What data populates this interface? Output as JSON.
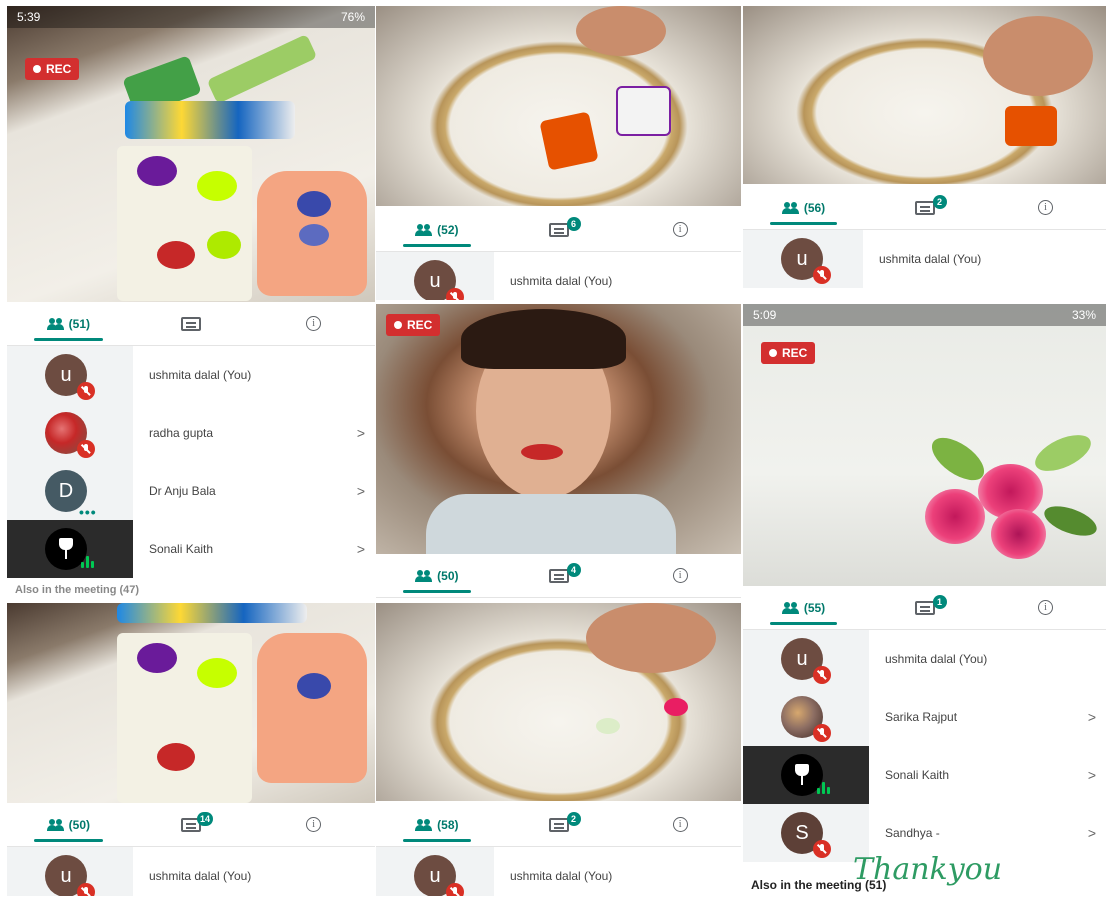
{
  "tiles": {
    "t1": {
      "status_time": "5:39",
      "battery": "76%",
      "rec_label": "REC",
      "participants_count": "(51)",
      "rows": [
        {
          "avatar": "u",
          "name": "ushmita dalal (You)"
        },
        {
          "avatar": "",
          "name": "radha gupta"
        },
        {
          "avatar": "D",
          "name": "Dr Anju Bala"
        },
        {
          "avatar": "",
          "name": "Sonali Kaith"
        }
      ],
      "also_label": "Also in the meeting (47)"
    },
    "t2": {
      "participants_count": "(52)",
      "chat_badge": "6",
      "rows": [
        {
          "avatar": "u",
          "name": "ushmita dalal (You)"
        }
      ]
    },
    "t3": {
      "participants_count": "(56)",
      "chat_badge": "2",
      "rows": [
        {
          "avatar": "u",
          "name": "ushmita dalal (You)"
        }
      ]
    },
    "t4": {
      "rec_label": "REC",
      "participants_count": "(50)",
      "chat_badge": "4"
    },
    "t5": {
      "status_time": "5:09",
      "battery": "33%",
      "rec_label": "REC",
      "participants_count": "(55)",
      "chat_badge": "1",
      "rows": [
        {
          "avatar": "u",
          "name": "ushmita dalal (You)"
        },
        {
          "avatar": "",
          "name": "Sarika Rajput"
        },
        {
          "avatar": "",
          "name": "Sonali Kaith"
        },
        {
          "avatar": "S",
          "name": "Sandhya -"
        }
      ],
      "also_label": "Also in the meeting (51)",
      "scribble": "Thankyou"
    },
    "t6": {
      "participants_count": "(50)",
      "chat_badge": "14",
      "rows": [
        {
          "avatar": "u",
          "name": "ushmita dalal (You)"
        }
      ]
    },
    "t7": {
      "participants_count": "(58)",
      "chat_badge": "2",
      "rows": [
        {
          "avatar": "u",
          "name": "ushmita dalal (You)"
        }
      ]
    }
  },
  "icons": {
    "people": "people-icon",
    "chat": "chat-icon",
    "info": "info-icon",
    "mic_off": "mic-off-icon",
    "chevron": "chevron-right-icon",
    "rec_dot": "record-dot-icon"
  },
  "colors": {
    "accent": "#00897b",
    "rec": "#d32f2f",
    "mic_off": "#d93025"
  },
  "chevron_glyph": ">",
  "info_glyph": "i"
}
